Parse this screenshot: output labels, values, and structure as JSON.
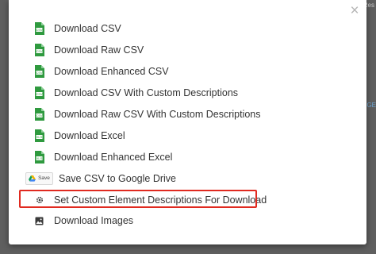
{
  "backdrop": {
    "corner_text": "Res",
    "right_text": "GE"
  },
  "modal": {
    "close_symbol": "×",
    "items": [
      {
        "label": "Download CSV",
        "icon": "csv-file-icon"
      },
      {
        "label": "Download Raw CSV",
        "icon": "csv-file-icon"
      },
      {
        "label": "Download Enhanced CSV",
        "icon": "csv-file-icon"
      },
      {
        "label": "Download CSV With Custom Descriptions",
        "icon": "csv-file-icon"
      },
      {
        "label": "Download Raw CSV With Custom Descriptions",
        "icon": "csv-file-icon"
      },
      {
        "label": "Download Excel",
        "icon": "xls-file-icon"
      },
      {
        "label": "Download Enhanced Excel",
        "icon": "xls-file-icon"
      },
      {
        "label": "Save CSV to Google Drive",
        "icon": "google-drive-save-badge",
        "badge": "Save"
      },
      {
        "label": "Set Custom Element Descriptions For Download",
        "icon": "gear-icon",
        "highlighted": true
      },
      {
        "label": "Download Images",
        "icon": "image-icon"
      }
    ]
  },
  "colors": {
    "file_icon_green": "#2f9a3f",
    "highlight_red": "#e02a20",
    "text": "#333333"
  }
}
